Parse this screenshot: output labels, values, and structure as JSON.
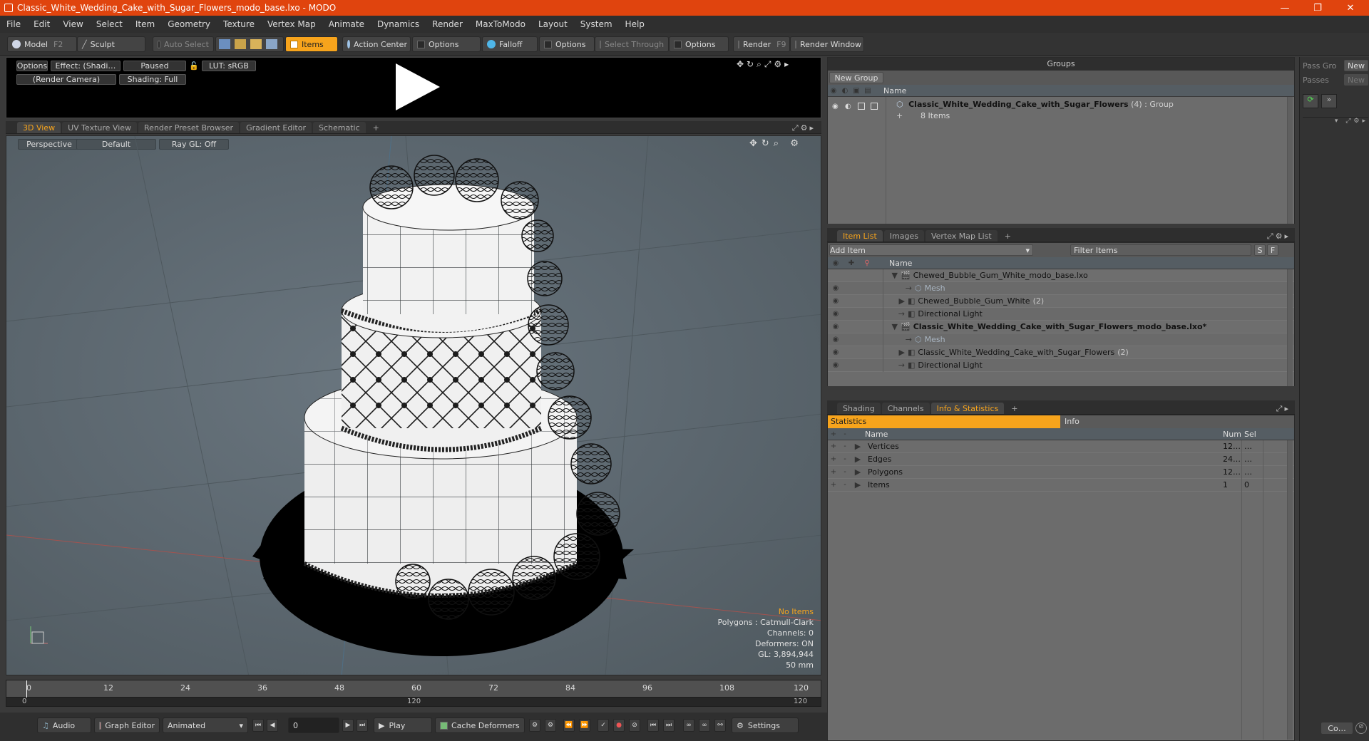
{
  "window": {
    "title": "Classic_White_Wedding_Cake_with_Sugar_Flowers_modo_base.lxo - MODO",
    "minimize": "—",
    "maximize": "❐",
    "close": "✕"
  },
  "menu": [
    "File",
    "Edit",
    "View",
    "Select",
    "Item",
    "Geometry",
    "Texture",
    "Vertex Map",
    "Animate",
    "Dynamics",
    "Render",
    "MaxToModo",
    "Layout",
    "System",
    "Help"
  ],
  "toolbar": {
    "model": "Model",
    "model_key": "F2",
    "sculpt": "Sculpt",
    "auto_select": "Auto Select",
    "items": "Items",
    "action_center": "Action Center",
    "options1": "Options",
    "falloff": "Falloff",
    "options2": "Options",
    "select_through": "Select Through",
    "options3": "Options",
    "render": "Render",
    "render_key": "F9",
    "render_window": "Render Window"
  },
  "preview": {
    "options": "Options",
    "effect": "Effect: (Shadi…",
    "paused": "Paused",
    "lut": "LUT: sRGB",
    "camera": "(Render Camera)",
    "shading": "Shading: Full"
  },
  "viewport_tabs": [
    "3D View",
    "UV Texture View",
    "Render Preset Browser",
    "Gradient Editor",
    "Schematic",
    "+"
  ],
  "viewport_buttons": {
    "perspective": "Perspective",
    "default": "Default",
    "raygl": "Ray GL: Off"
  },
  "viewport_stats": {
    "no_items": "No Items",
    "polygons": "Polygons : Catmull-Clark",
    "channels": "Channels: 0",
    "deformers": "Deformers: ON",
    "gl": "GL: 3,894,944",
    "lens": "50 mm"
  },
  "timeline": {
    "ticks": [
      "0",
      "12",
      "24",
      "36",
      "48",
      "60",
      "72",
      "84",
      "96",
      "108",
      "120"
    ],
    "range_start": "0",
    "range_mid": "120",
    "range_end": "120"
  },
  "bottombar": {
    "audio": "Audio",
    "graph_editor": "Graph Editor",
    "animated": "Animated",
    "frame": "0",
    "play": "Play",
    "cache_deformers": "Cache Deformers",
    "settings": "Settings"
  },
  "groups": {
    "title": "Groups",
    "new_group": "New Group",
    "col_name": "Name",
    "item_name": "Classic_White_Wedding_Cake_with_Sugar_Flowers",
    "item_count": "(4)",
    "item_type": ": Group",
    "item_sub": "8 Items"
  },
  "side": {
    "pass_group": "Pass Gro",
    "new1": "New",
    "passes": "Passes",
    "new2": "New",
    "collapse": "Co…"
  },
  "itemlist": {
    "tabs": [
      "Item List",
      "Images",
      "Vertex Map List",
      "+"
    ],
    "add_item": "Add Item",
    "filter": "Filter Items",
    "s": "S",
    "f": "F",
    "col_name": "Name",
    "rows": [
      {
        "label": "Chewed_Bubble_Gum_White_modo_base.lxo",
        "count": "",
        "indent": 0,
        "bold": false,
        "dim": false
      },
      {
        "label": "Mesh",
        "count": "",
        "indent": 2,
        "bold": false,
        "dim": true
      },
      {
        "label": "Chewed_Bubble_Gum_White",
        "count": "(2)",
        "indent": 1,
        "bold": false,
        "dim": false
      },
      {
        "label": "Directional Light",
        "count": "",
        "indent": 1,
        "bold": false,
        "dim": false
      },
      {
        "label": "Classic_White_Wedding_Cake_with_Sugar_Flowers_modo_base.lxo*",
        "count": "",
        "indent": 0,
        "bold": true,
        "dim": false
      },
      {
        "label": "Mesh",
        "count": "",
        "indent": 2,
        "bold": false,
        "dim": true
      },
      {
        "label": "Classic_White_Wedding_Cake_with_Sugar_Flowers",
        "count": "(2)",
        "indent": 1,
        "bold": false,
        "dim": false
      },
      {
        "label": "Directional Light",
        "count": "",
        "indent": 1,
        "bold": false,
        "dim": false
      }
    ]
  },
  "stats": {
    "tabs": [
      "Shading",
      "Channels",
      "Info & Statistics",
      "+"
    ],
    "statistics": "Statistics",
    "info": "Info",
    "col_name": "Name",
    "col_num": "Num",
    "col_sel": "Sel",
    "rows": [
      {
        "name": "Vertices",
        "num": "12…",
        "sel": "…"
      },
      {
        "name": "Edges",
        "num": "24…",
        "sel": "…"
      },
      {
        "name": "Polygons",
        "num": "12…",
        "sel": "…"
      },
      {
        "name": "Items",
        "num": "1",
        "sel": "0"
      }
    ]
  },
  "colors": {
    "accent": "#f7a41c",
    "titlebar": "#e0440e"
  }
}
